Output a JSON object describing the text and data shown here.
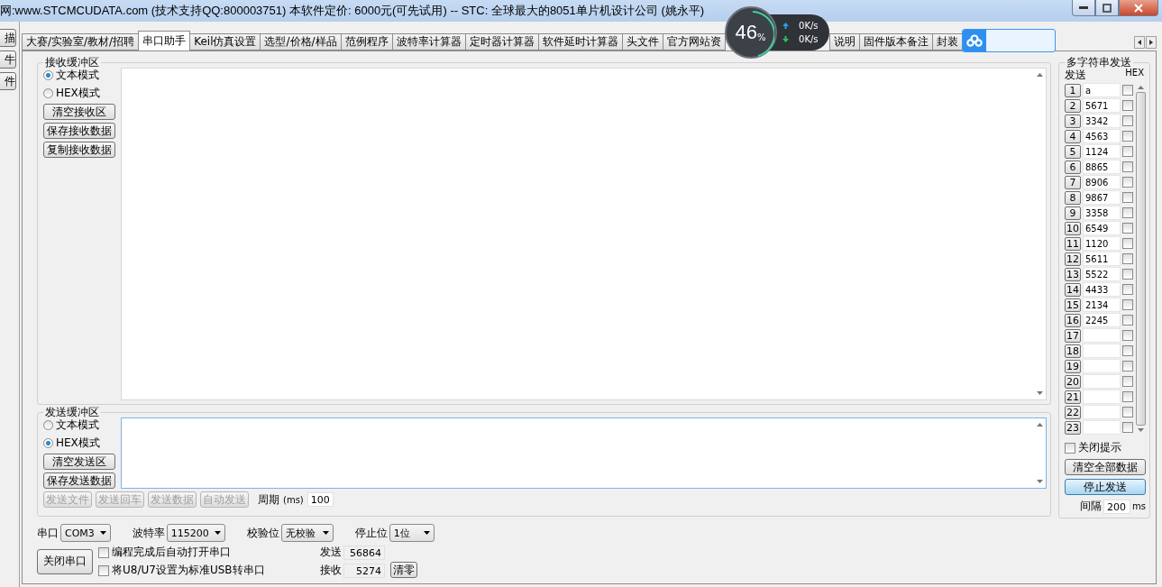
{
  "window": {
    "title": "网:www.STCMCUDATA.com  (技术支持QQ:800003751) 本软件定价: 6000元(可先试用) -- STC: 全球最大的8051单片机设计公司 (姚永平)"
  },
  "left_strip": {
    "buttons": [
      "描",
      "牛",
      "件"
    ]
  },
  "tabs": [
    {
      "label": "大赛/实验室/教材/招聘",
      "selected": false
    },
    {
      "label": "串口助手",
      "selected": true
    },
    {
      "label": "Keil仿真设置",
      "selected": false
    },
    {
      "label": "选型/价格/样品",
      "selected": false
    },
    {
      "label": "范例程序",
      "selected": false
    },
    {
      "label": "波特率计算器",
      "selected": false
    },
    {
      "label": "定时器计算器",
      "selected": false
    },
    {
      "label": "软件延时计算器",
      "selected": false
    },
    {
      "label": "头文件",
      "selected": false
    },
    {
      "label": "官方网站资",
      "selected": false
    },
    {
      "label": "说明",
      "selected": false
    },
    {
      "label": "固件版本备注",
      "selected": false
    },
    {
      "label": "封装",
      "selected": false
    }
  ],
  "receive": {
    "title": "接收缓冲区",
    "modes": [
      {
        "label": "文本模式",
        "selected": true
      },
      {
        "label": "HEX模式",
        "selected": false
      }
    ],
    "buttons": [
      "清空接收区",
      "保存接收数据",
      "复制接收数据"
    ]
  },
  "send": {
    "title": "发送缓冲区",
    "modes": [
      {
        "label": "文本模式",
        "selected": false
      },
      {
        "label": "HEX模式",
        "selected": true
      }
    ],
    "buttons": [
      "清空发送区",
      "保存发送数据"
    ],
    "actions": [
      {
        "label": "发送文件",
        "disabled": true
      },
      {
        "label": "发送回车",
        "disabled": true
      },
      {
        "label": "发送数据",
        "disabled": true
      },
      {
        "label": "自动发送",
        "disabled": true
      }
    ],
    "period_label": "周期",
    "period_unit": "(ms)",
    "period_value": "100"
  },
  "port": {
    "fields": [
      {
        "label": "串口",
        "value": "COM3"
      },
      {
        "label": "波特率",
        "value": "115200"
      },
      {
        "label": "校验位",
        "value": "无校验"
      },
      {
        "label": "停止位",
        "value": "1位"
      }
    ],
    "close_button": "关闭串口",
    "options": [
      {
        "label": "编程完成后自动打开串口",
        "checked": false
      },
      {
        "label": "将U8/U7设置为标准USB转串口",
        "checked": false
      }
    ],
    "counters": [
      {
        "label": "发送",
        "value": "56864"
      },
      {
        "label": "接收",
        "value": "5274"
      }
    ],
    "clear_button": "清零"
  },
  "multi_send": {
    "title": "多字符串发送",
    "send_header": "发送",
    "hex_header": "HEX",
    "rows": [
      {
        "index": "1",
        "value": "a",
        "hex": false
      },
      {
        "index": "2",
        "value": "5671",
        "hex": false
      },
      {
        "index": "3",
        "value": "3342",
        "hex": false
      },
      {
        "index": "4",
        "value": "4563",
        "hex": false
      },
      {
        "index": "5",
        "value": "1124",
        "hex": false
      },
      {
        "index": "6",
        "value": "8865",
        "hex": false
      },
      {
        "index": "7",
        "value": "8906",
        "hex": false
      },
      {
        "index": "8",
        "value": "9867",
        "hex": false
      },
      {
        "index": "9",
        "value": "3358",
        "hex": false
      },
      {
        "index": "10",
        "value": "6549",
        "hex": false
      },
      {
        "index": "11",
        "value": "1120",
        "hex": false
      },
      {
        "index": "12",
        "value": "5611",
        "hex": false
      },
      {
        "index": "13",
        "value": "5522",
        "hex": false
      },
      {
        "index": "14",
        "value": "4433",
        "hex": false
      },
      {
        "index": "15",
        "value": "2134",
        "hex": false
      },
      {
        "index": "16",
        "value": "2245",
        "hex": false
      },
      {
        "index": "17",
        "hex": false
      },
      {
        "index": "18",
        "hex": false
      },
      {
        "index": "19",
        "hex": false
      },
      {
        "index": "20",
        "hex": false
      },
      {
        "index": "21",
        "hex": false
      },
      {
        "index": "22",
        "hex": false
      },
      {
        "index": "23",
        "hex": false
      }
    ],
    "close_hint": {
      "label": "关闭提示",
      "checked": false
    },
    "clear_all_button": "清空全部数据",
    "stop_button": "停止发送",
    "interval_label": "间隔",
    "interval_value": "200",
    "interval_unit": "ms"
  },
  "net_monitor": {
    "percent": "46",
    "unit": "%",
    "upload": "0K/s",
    "download": "0K/s"
  }
}
